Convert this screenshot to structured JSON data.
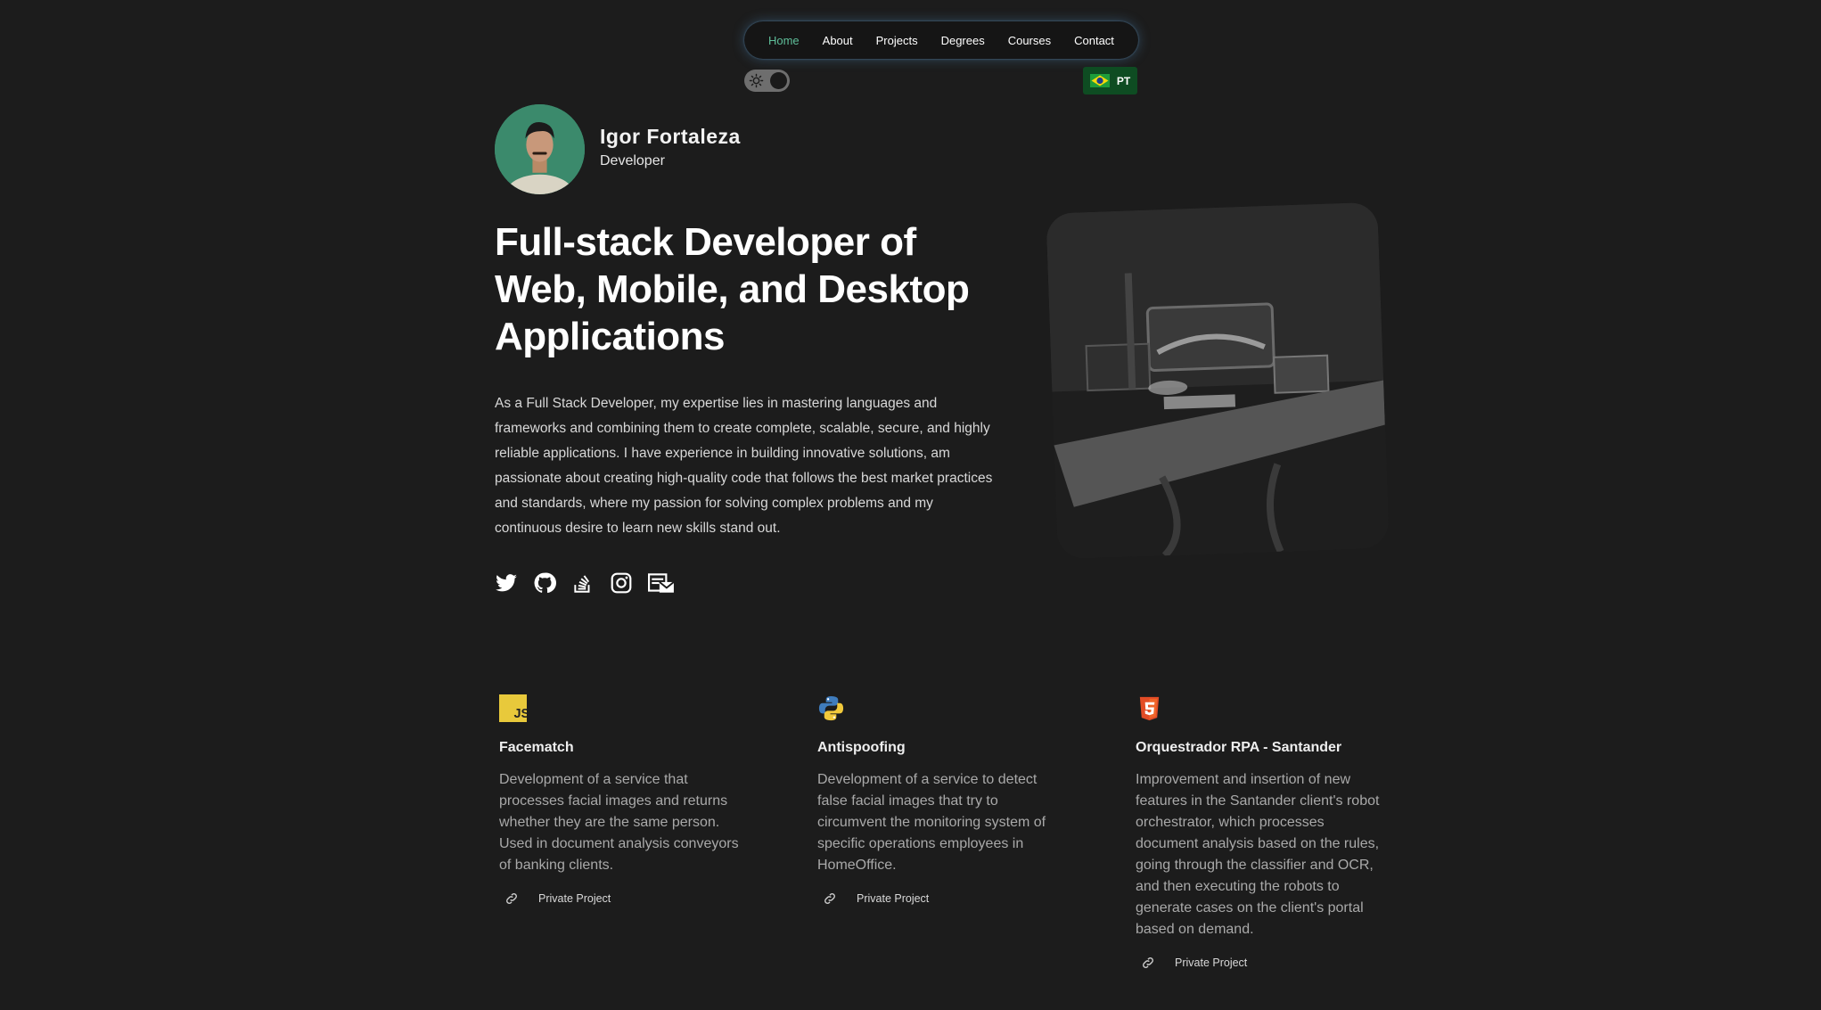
{
  "nav": {
    "items": [
      {
        "label": "Home",
        "active": true
      },
      {
        "label": "About"
      },
      {
        "label": "Projects"
      },
      {
        "label": "Degrees"
      },
      {
        "label": "Courses"
      },
      {
        "label": "Contact"
      }
    ],
    "accent_color": "#5fbf9a"
  },
  "theme_toggle": {
    "icon": "sun-icon",
    "state": "dark"
  },
  "language": {
    "code": "PT",
    "flag": "brazil-flag-icon"
  },
  "profile": {
    "name": "Igor Fortaleza",
    "role": "Developer"
  },
  "hero": {
    "headline": "Full-stack Developer of Web, Mobile, and Desktop Applications",
    "description": "As a Full Stack Developer, my expertise lies in mastering languages and frameworks and combining them to create complete, scalable, secure, and highly reliable applications. I have experience in building innovative solutions, am passionate about creating high-quality code that follows the best market practices and standards, where my passion for solving complex problems and my continuous desire to learn new skills stand out."
  },
  "socials": [
    "twitter-icon",
    "github-icon",
    "stackoverflow-icon",
    "instagram-icon",
    "email-icon"
  ],
  "projects": [
    {
      "icon": "javascript-icon",
      "title": "Facematch",
      "description": "Development of a service that processes facial images and returns whether they are the same person. Used in document analysis conveyors of banking clients.",
      "link_label": "Private Project"
    },
    {
      "icon": "python-icon",
      "title": "Antispoofing",
      "description": "Development of a service to detect false facial images that try to circumvent the monitoring system of specific operations employees in HomeOffice.",
      "link_label": "Private Project"
    },
    {
      "icon": "html5-icon",
      "title": "Orquestrador RPA - Santander",
      "description": "Improvement and insertion of new features in the Santander client's robot orchestrator, which processes document analysis based on the rules, going through the classifier and OCR, and then executing the robots to generate cases on the client's portal based on demand.",
      "link_label": "Private Project"
    }
  ]
}
